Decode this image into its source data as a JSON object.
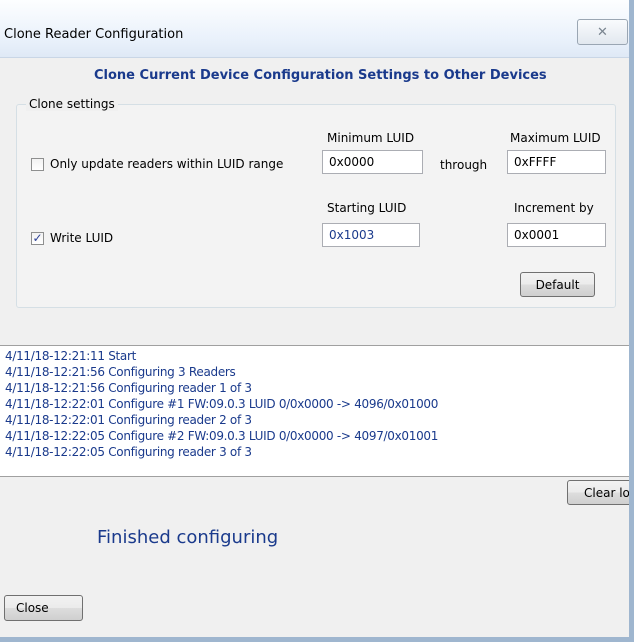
{
  "window": {
    "title": "Clone Reader Configuration",
    "close_glyph": "✕"
  },
  "header": {
    "text": "Clone Current Device Configuration Settings to Other Devices"
  },
  "clone_settings": {
    "group_label": "Clone settings",
    "min_luid_label": "Minimum LUID",
    "max_luid_label": "Maximum LUID",
    "min_luid_value": "0x0000",
    "max_luid_value": "0xFFFF",
    "through_label": "through",
    "only_update_label": "Only update readers within LUID range",
    "only_update_checked": false,
    "starting_luid_label": "Starting LUID",
    "increment_label": "Increment by",
    "starting_luid_value": "0x1003",
    "increment_value": "0x0001",
    "write_luid_label": "Write LUID",
    "write_luid_checked": true,
    "write_luid_glyph": "✓",
    "default_button": "Default"
  },
  "log": {
    "lines": [
      "4/11/18-12:21:11 Start",
      "4/11/18-12:21:56 Configuring 3 Readers",
      "4/11/18-12:21:56 Configuring reader 1 of 3",
      "4/11/18-12:22:01 Configure #1 FW:09.0.3 LUID 0/0x0000 -> 4096/0x01000",
      "4/11/18-12:22:01 Configuring reader 2 of 3",
      "4/11/18-12:22:05 Configure #2 FW:09.0.3 LUID 0/0x0000 -> 4097/0x01001",
      "4/11/18-12:22:05 Configuring reader 3 of 3"
    ]
  },
  "clear_log_button": "Clear lo",
  "status_text": "Finished configuring",
  "close_button": "Close"
}
